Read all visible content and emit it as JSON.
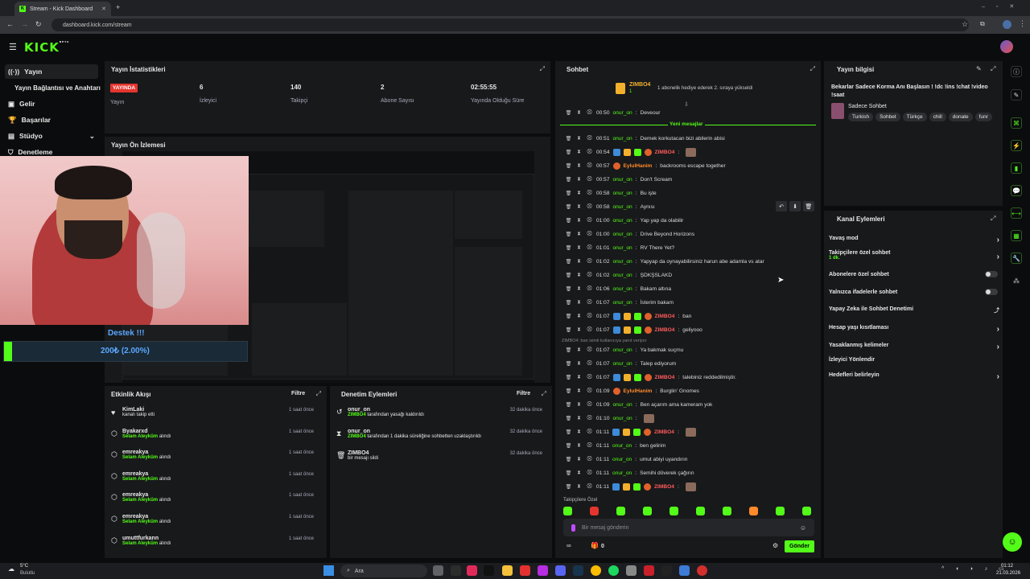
{
  "browser": {
    "tab_title": "Stream - Kick Dashboard",
    "url": "dashboard.kick.com/stream"
  },
  "brand": {
    "logo": "KICK",
    "beta": "BETA",
    "accent": "#53fc18"
  },
  "sidebar": {
    "items": [
      {
        "label": "Yayın",
        "icon": "broadcast-icon"
      },
      {
        "label": "Yayın Bağlantısı ve Anahtarı",
        "icon": "key-icon"
      },
      {
        "label": "Gelir",
        "icon": "wallet-icon"
      },
      {
        "label": "Başarılar",
        "icon": "trophy-icon"
      },
      {
        "label": "Stüdyo",
        "icon": "studio-icon"
      },
      {
        "label": "Denetleme",
        "icon": "shield-icon"
      }
    ]
  },
  "stats": {
    "title": "Yayın İstatistikleri",
    "live_badge": "YAYINDA",
    "live_label": "Yayın",
    "viewers": "6",
    "viewers_label": "İzleyici",
    "followers": "140",
    "followers_label": "Takipçi",
    "subs": "2",
    "subs_label": "Abone Sayısı",
    "uptime": "02:55:55",
    "uptime_label": "Yayında Olduğu Süre"
  },
  "preview": {
    "title": "Yayın Ön İzlemesi"
  },
  "donation": {
    "title": "Destek !!!",
    "amount": "200₺ (2.00%)",
    "progress": 0.02
  },
  "activity": {
    "title": "Etkinlik Akışı",
    "filter": "Filtre",
    "items": [
      {
        "name": "KimLaki",
        "sub": "kanalı takip etti",
        "time": "1 saat önce",
        "green": false
      },
      {
        "name": "Byakarxd",
        "sub": "Selam Aleyküm",
        "sub2": "alındı",
        "time": "1 saat önce",
        "green": true
      },
      {
        "name": "emreakya",
        "sub": "Selam Aleyküm",
        "sub2": "alındı",
        "time": "1 saat önce",
        "green": true
      },
      {
        "name": "emreakya",
        "sub": "Selam Aleyküm",
        "sub2": "alındı",
        "time": "1 saat önce",
        "green": true
      },
      {
        "name": "emreakya",
        "sub": "Selam Aleyküm",
        "sub2": "alındı",
        "time": "1 saat önce",
        "green": true
      },
      {
        "name": "emreakya",
        "sub": "Selam Aleyküm",
        "sub2": "alındı",
        "time": "1 saat önce",
        "green": true
      },
      {
        "name": "umuttfurkann",
        "sub": "Selam Aleyküm",
        "sub2": "alındı",
        "time": "1 saat önce",
        "green": true
      }
    ]
  },
  "moderation": {
    "title": "Denetim Eylemleri",
    "filter": "Filtre",
    "items": [
      {
        "name": "onur_on",
        "actor": "ZIMBO4",
        "text": "tarafından yasağı kaldırıldı",
        "time": "32 dakika önce"
      },
      {
        "name": "onur_on",
        "actor": "ZIMBO4",
        "text": "tarafından 1 dakika süreliğine sohbetten uzaklaştırıldı",
        "time": "32 dakika önce"
      },
      {
        "name": "ZIMBO4",
        "actor": "",
        "text": "bir mesajı sildi",
        "time": "32 dakika önce"
      }
    ]
  },
  "chat": {
    "title": "Sohbet",
    "pinned_user": "ZIMBO4",
    "pinned_sub": "1",
    "gift_note": "1 abonelik hediye ederek 2. sıraya yükseldi",
    "new_messages": "Yeni mesajlar",
    "reply_note": "ZIMBO4: ban isimli kullanıcıya yanıt veriyor",
    "messages": [
      {
        "time": "00:50",
        "user": "onur_on",
        "text": "Deveour",
        "color": "green"
      },
      {
        "time": "00:51",
        "user": "onur_on",
        "text": "Demek korkutacan bizi abilerin abisi",
        "color": "green"
      },
      {
        "time": "00:54",
        "user": "ZIMBO4",
        "text": "",
        "color": "red",
        "badges": true
      },
      {
        "time": "00:57",
        "user": "EylulHanim",
        "text": "backrooms escape together",
        "color": "orange"
      },
      {
        "time": "00:57",
        "user": "onur_on",
        "text": "Don't Scream",
        "color": "green"
      },
      {
        "time": "00:58",
        "user": "onur_on",
        "text": "Bu işte",
        "color": "green"
      },
      {
        "time": "00:58",
        "user": "onur_on",
        "text": "Aynısı",
        "color": "green"
      },
      {
        "time": "01:00",
        "user": "onur_on",
        "text": "Yap yap da olabilir",
        "color": "green"
      },
      {
        "time": "01:00",
        "user": "onur_on",
        "text": "Drive Beyond Horizons",
        "color": "green"
      },
      {
        "time": "01:01",
        "user": "onur_on",
        "text": "RV There Yet?",
        "color": "green"
      },
      {
        "time": "01:02",
        "user": "onur_on",
        "text": "Yapyap da oynayabilirsiniz harun abe adamla vs atar",
        "color": "green"
      },
      {
        "time": "01:02",
        "user": "onur_on",
        "text": "ŞDKŞSLAKD",
        "color": "green"
      },
      {
        "time": "01:06",
        "user": "onur_on",
        "text": "Bakam altına",
        "color": "green"
      },
      {
        "time": "01:07",
        "user": "onur_on",
        "text": "İsterim bakam",
        "color": "green"
      },
      {
        "time": "01:07",
        "user": "ZIMBO4",
        "text": "ban",
        "color": "red",
        "badges": true
      },
      {
        "time": "01:07",
        "user": "ZIMBO4",
        "text": "geliyooo",
        "color": "red",
        "badges": true
      },
      {
        "time": "01:07",
        "user": "onur_on",
        "text": "Ya bakmak suçmu",
        "color": "green"
      },
      {
        "time": "01:07",
        "user": "onur_on",
        "text": "Talep ediyorum",
        "color": "green"
      },
      {
        "time": "01:07",
        "user": "ZIMBO4",
        "text": "talebiniz reddedilmiştir.",
        "color": "red",
        "badges": true
      },
      {
        "time": "01:09",
        "user": "EylulHanim",
        "text": "Burglin' Gnomes",
        "color": "orange"
      },
      {
        "time": "01:09",
        "user": "onur_on",
        "text": "Ben açarım ama kameram yok",
        "color": "green"
      },
      {
        "time": "01:10",
        "user": "onur_on",
        "text": "",
        "color": "green"
      },
      {
        "time": "01:11",
        "user": "ZIMBO4",
        "text": "",
        "color": "red",
        "badges": true
      },
      {
        "time": "01:11",
        "user": "onur_on",
        "text": "ben gelirim",
        "color": "green"
      },
      {
        "time": "01:11",
        "user": "onur_on",
        "text": "umut abiyi uyandırın",
        "color": "green"
      },
      {
        "time": "01:11",
        "user": "onur_on",
        "text": "Semihi döverek çağırın",
        "color": "green"
      },
      {
        "time": "01:11",
        "user": "ZIMBO4",
        "text": "",
        "color": "red",
        "badges": true
      }
    ],
    "followers_only": "Takipçilere Özel",
    "input_placeholder": "Bir mesaj gönderin",
    "points": "0",
    "send": "Gönder"
  },
  "stream_info": {
    "title": "Yayın bilgisi",
    "stream_title": "Bekarlar Sadece Korma Anı Başlasın ! !dc !ins !chat !video !saat",
    "category": "Sadece Sohbet",
    "tags": [
      "Turkish",
      "Sohbet",
      "Türkçe",
      "chill",
      "donate",
      "funr"
    ]
  },
  "channel_actions": {
    "title": "Kanal Eylemleri",
    "slow_mode": "Yavaş mod",
    "followers_chat": "Takipçilere özel sohbet",
    "followers_chat_sub": "1 dk.",
    "subs_chat": "Abonelere özel sohbet",
    "emote_chat": "Yalnızca ifadelerle sohbet",
    "ai_mod": "Yapay Zeka ile Sohbet Denetimi",
    "age_limit": "Hesap yaşı kısıtlaması",
    "banned_words": "Yasaklanmış kelimeler",
    "viewer_redirect": "İzleyici Yönlendir",
    "goals": "Hedefleri belirleyin"
  },
  "taskbar": {
    "weather_temp": "5°C",
    "weather_text": "Bulutlu",
    "search": "Ara",
    "clock_time": "01:12",
    "clock_date": "21.03.2026"
  }
}
